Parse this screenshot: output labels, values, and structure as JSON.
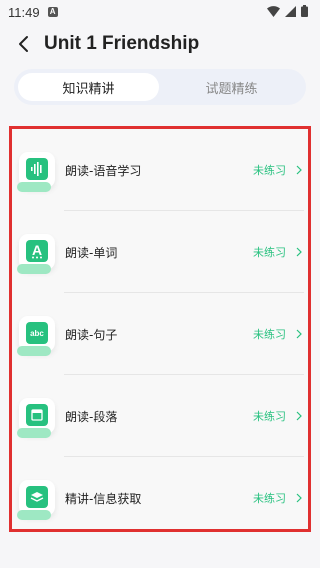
{
  "status_bar": {
    "time": "11:49",
    "app_badge": "A"
  },
  "header": {
    "title": "Unit 1 Friendship"
  },
  "tabs": [
    {
      "label": "知识精讲",
      "active": true
    },
    {
      "label": "试题精练",
      "active": false
    }
  ],
  "items": [
    {
      "label": "朗读-语音学习",
      "status": "未练习",
      "icon": "waveform-icon"
    },
    {
      "label": "朗读-单词",
      "status": "未练习",
      "icon": "letter-a-icon"
    },
    {
      "label": "朗读-句子",
      "status": "未练习",
      "icon": "abc-icon"
    },
    {
      "label": "朗读-段落",
      "status": "未练习",
      "icon": "paragraph-icon"
    },
    {
      "label": "精讲-信息获取",
      "status": "未练习",
      "icon": "layers-icon"
    }
  ],
  "colors": {
    "accent": "#27c17f",
    "highlight": "#e03030",
    "tab_bg": "#edf0f8"
  }
}
